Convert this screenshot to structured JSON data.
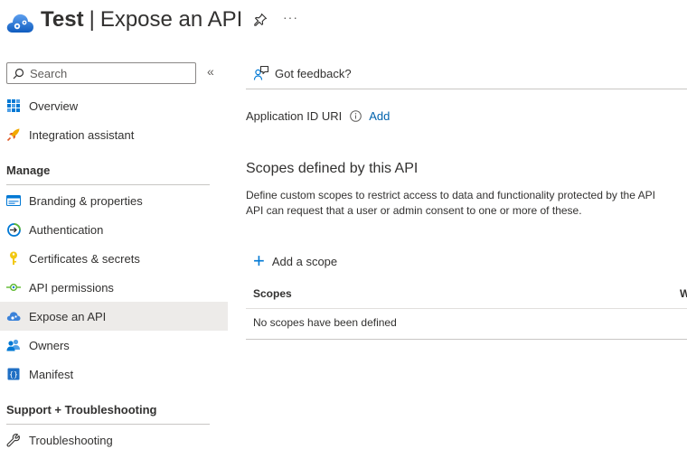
{
  "header": {
    "app_name": "Test",
    "separator": "|",
    "page_title": "Expose an API",
    "more_label": "···"
  },
  "sidebar": {
    "search_placeholder": "Search",
    "collapse_label": "«",
    "items_top": [
      {
        "label": "Overview",
        "icon": "overview-grid-icon"
      },
      {
        "label": "Integration assistant",
        "icon": "rocket-icon"
      }
    ],
    "manage_heading": "Manage",
    "manage_items": [
      {
        "label": "Branding & properties",
        "icon": "branding-card-icon"
      },
      {
        "label": "Authentication",
        "icon": "authentication-icon"
      },
      {
        "label": "Certificates & secrets",
        "icon": "key-icon"
      },
      {
        "label": "API permissions",
        "icon": "api-permissions-icon"
      },
      {
        "label": "Expose an API",
        "icon": "cloud-icon",
        "active": true
      },
      {
        "label": "Owners",
        "icon": "owners-icon"
      },
      {
        "label": "Manifest",
        "icon": "manifest-icon"
      }
    ],
    "support_heading": "Support + Troubleshooting",
    "support_items": [
      {
        "label": "Troubleshooting",
        "icon": "wrench-icon"
      }
    ]
  },
  "main": {
    "feedback_label": "Got feedback?",
    "app_id_label": "Application ID URI",
    "app_id_action": "Add",
    "scopes_title": "Scopes defined by this API",
    "description_line1": "Define custom scopes to restrict access to data and functionality protected by the API",
    "description_line2": "API can request that a user or admin consent to one or more of these.",
    "add_scope_label": "Add a scope",
    "table": {
      "columns": [
        "Scopes",
        "W"
      ],
      "empty_message": "No scopes have been defined"
    }
  },
  "colors": {
    "accent": "#0078d4",
    "link": "#0062ad",
    "active_bg": "#edebe9"
  }
}
